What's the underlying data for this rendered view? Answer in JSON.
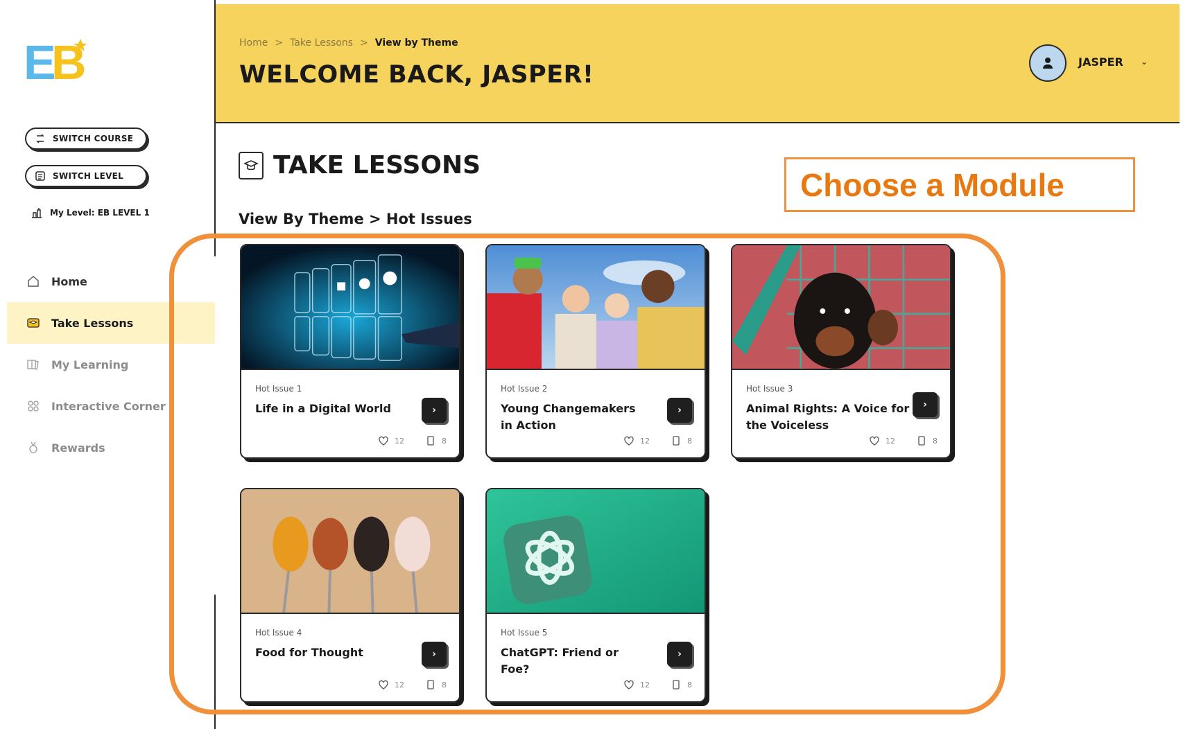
{
  "logo": {
    "text": "EB"
  },
  "sidebar": {
    "switch_course_label": "SWITCH COURSE",
    "switch_level_label": "SWITCH LEVEL",
    "my_level_label": "My Level: EB LEVEL 1",
    "nav": [
      {
        "label": "Home",
        "icon": "home-icon"
      },
      {
        "label": "Take Lessons",
        "icon": "lessons-icon",
        "active": true
      },
      {
        "label": "My Learning",
        "icon": "book-icon"
      },
      {
        "label": "Interactive Corner",
        "icon": "grid-icon"
      },
      {
        "label": "Rewards",
        "icon": "medal-icon"
      }
    ]
  },
  "header": {
    "breadcrumb": [
      "Home",
      "Take Lessons",
      "View by Theme"
    ],
    "breadcrumb_sep": ">",
    "welcome": "WELCOME BACK, JASPER!",
    "user_name": "JASPER",
    "user_chevron": "⌄"
  },
  "main": {
    "title": "TAKE LESSONS",
    "subtitle": "View By Theme > Hot Issues",
    "callout": "Choose a Module",
    "cards": [
      {
        "label": "Hot Issue 1",
        "title": "Life in a Digital World",
        "likes": "12",
        "lessons": "8"
      },
      {
        "label": "Hot Issue 2",
        "title": "Young Changemakers in Action",
        "likes": "12",
        "lessons": "8"
      },
      {
        "label": "Hot Issue 3",
        "title": "Animal Rights: A Voice for the Voiceless",
        "likes": "12",
        "lessons": "8"
      },
      {
        "label": "Hot Issue 4",
        "title": "Food for Thought",
        "likes": "12",
        "lessons": "8"
      },
      {
        "label": "Hot Issue 5",
        "title": "ChatGPT: Friend or Foe?",
        "likes": "12",
        "lessons": "8"
      }
    ],
    "go_glyph": "›"
  },
  "colors": {
    "header_bg": "#f6d35c",
    "accent_orange": "#f0903a",
    "callout_text": "#e87810",
    "active_nav_bg": "#fdf3c4",
    "logo_blue": "#5bb8e8",
    "logo_yellow": "#f6c21e"
  }
}
